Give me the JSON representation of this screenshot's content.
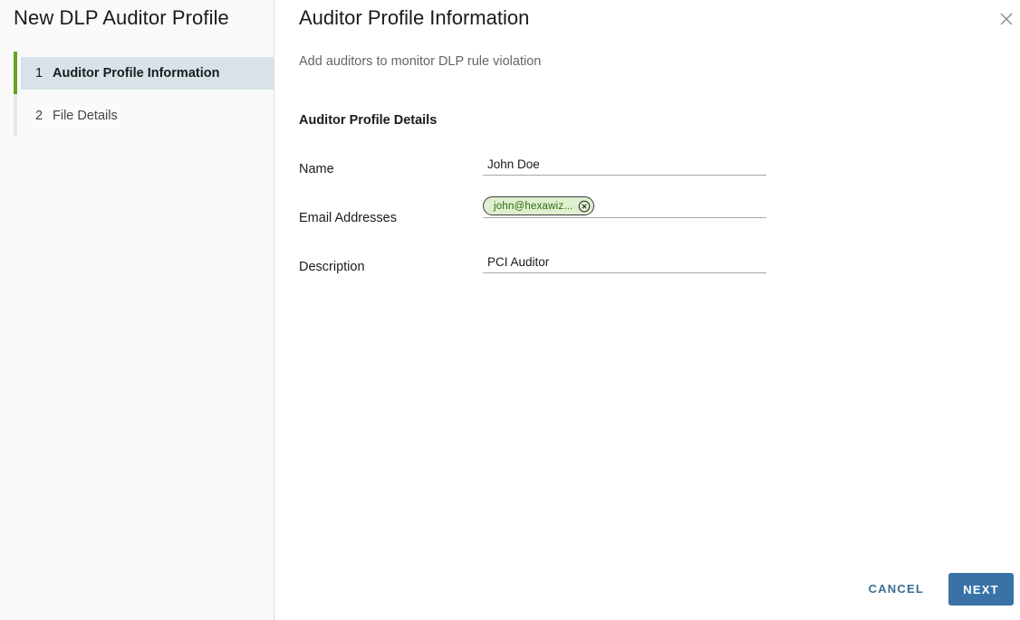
{
  "wizard": {
    "title": "New DLP Auditor Profile",
    "steps": [
      {
        "number": "1",
        "label": "Auditor Profile Information",
        "active": true
      },
      {
        "number": "2",
        "label": "File Details",
        "active": false
      }
    ]
  },
  "page": {
    "title": "Auditor Profile Information",
    "subtitle": "Add auditors to monitor DLP rule violation",
    "section_title": "Auditor Profile Details",
    "close_icon": "close-icon"
  },
  "form": {
    "name": {
      "label": "Name",
      "value": "John Doe"
    },
    "email": {
      "label": "Email Addresses",
      "chips": [
        {
          "text": "john@hexawiz...",
          "remove_icon": "remove-circle-icon"
        }
      ]
    },
    "description": {
      "label": "Description",
      "value": "PCI Auditor"
    }
  },
  "footer": {
    "cancel_label": "CANCEL",
    "next_label": "NEXT"
  },
  "colors": {
    "active_step_bar": "#62a420",
    "active_step_bg": "#d8e3e9",
    "chip_bg": "#dff0d0",
    "chip_text": "#2e6b10",
    "primary_button": "#3a72a6",
    "link_button": "#3a6e96"
  }
}
